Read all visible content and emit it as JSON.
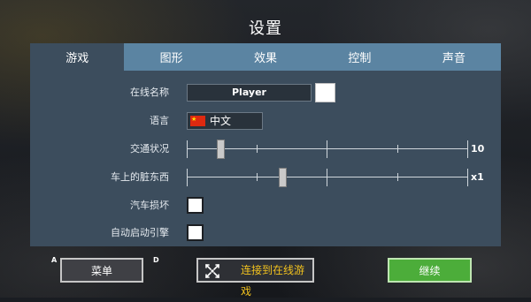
{
  "screen": {
    "title": "设置"
  },
  "tabs": [
    {
      "label": "游戏",
      "active": true
    },
    {
      "label": "图形",
      "active": false
    },
    {
      "label": "效果",
      "active": false
    },
    {
      "label": "控制",
      "active": false
    },
    {
      "label": "声音",
      "active": false
    }
  ],
  "settings": {
    "online_name": {
      "label": "在线名称",
      "value": "Player",
      "color": "#ffffff"
    },
    "language": {
      "label": "语言",
      "value": "中文",
      "flag_icon": "china-flag-icon"
    },
    "traffic": {
      "label": "交通状况",
      "value_label": "10",
      "level": 0.12
    },
    "dirt": {
      "label": "车上的脏东西",
      "value_label": "x1",
      "level": 0.34
    },
    "car_damage": {
      "label": "汽车损坏",
      "checked": false
    },
    "auto_start_engine": {
      "label": "自动启动引擎",
      "checked": false
    }
  },
  "footer": {
    "menu_key": "A",
    "menu_label": "菜单",
    "online_key": "D",
    "online_label": "连接到在线游戏",
    "online_icon": "network-arrows-icon",
    "continue_label": "继续"
  },
  "colors": {
    "tab_bar": "#5b84a2",
    "panel": "#3c4d5d",
    "continue": "#4cad3a",
    "online_text": "#f2c21e"
  }
}
